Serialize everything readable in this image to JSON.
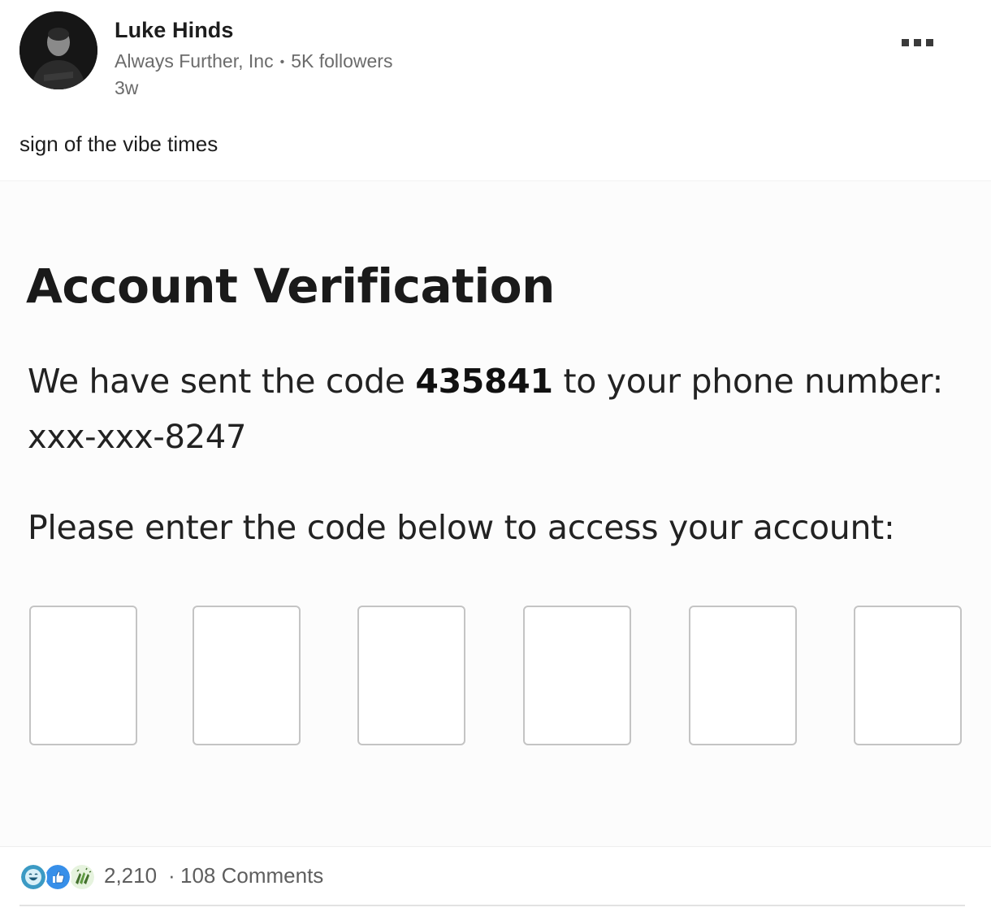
{
  "author": {
    "name": "Luke Hinds",
    "company": "Always Further, Inc",
    "followers": "5K followers",
    "time": "3w"
  },
  "post": {
    "text": "sign of the vibe times"
  },
  "screenshot": {
    "title": "Account Verification",
    "line1_prefix": "We have sent the code ",
    "code": "435841",
    "line1_suffix": " to your phone number:",
    "phone": "xxx-xxx-8247",
    "line2": "Please enter the code below to access your account:",
    "code_boxes": [
      "",
      "",
      "",
      "",
      "",
      ""
    ]
  },
  "social": {
    "reaction_icons": [
      "funny-icon",
      "like-icon",
      "celebrate-icon"
    ],
    "reactions_count": "2,210",
    "separator": "·",
    "comments": "108 Comments"
  },
  "colors": {
    "funny": "#3b9ac4",
    "like": "#378fe9",
    "celebrate": "#44712e"
  }
}
